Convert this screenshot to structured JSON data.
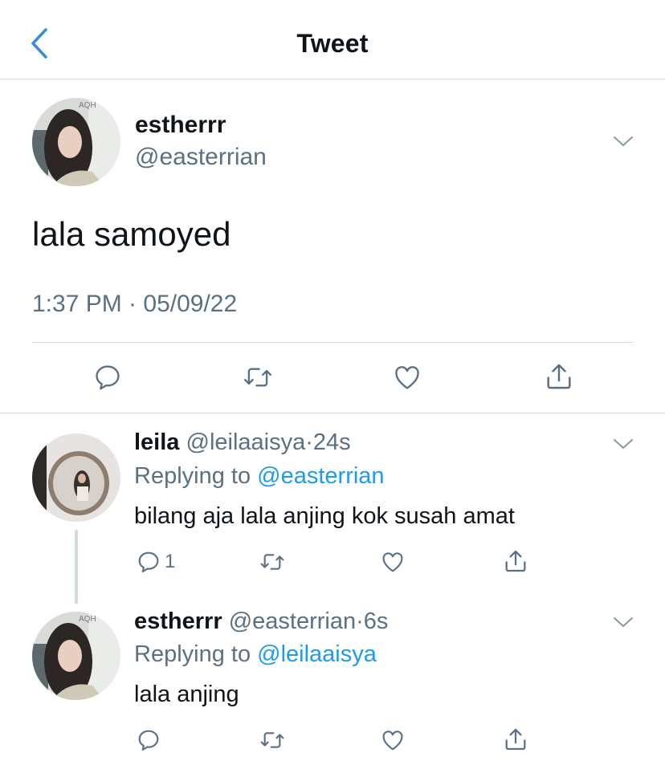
{
  "header": {
    "title": "Tweet"
  },
  "main_tweet": {
    "name": "estherrr",
    "handle": "@easterrian",
    "text": "lala samoyed",
    "timestamp": "1:37 PM · 05/09/22",
    "actions": [
      "reply-icon",
      "retweet-icon",
      "like-icon",
      "share-icon"
    ]
  },
  "replies": [
    {
      "name": "leila",
      "handle": "@leilaaisya",
      "sep": "·",
      "time": "24s",
      "replying_prefix": "Replying to",
      "replying_to": "@easterrian",
      "text": "bilang aja lala anjing kok susah amat",
      "reply_count": "1"
    },
    {
      "name": "estherrr",
      "handle": "@easterrian",
      "sep": "·",
      "time": "6s",
      "replying_prefix": "Replying to",
      "replying_to": "@leilaaisya",
      "text": "lala anjing",
      "reply_count": ""
    }
  ],
  "colors": {
    "accent": "#1d9bf0",
    "secondary_text": "#5b7083",
    "icon": "#5b7083",
    "back": "#3b8bd8"
  }
}
